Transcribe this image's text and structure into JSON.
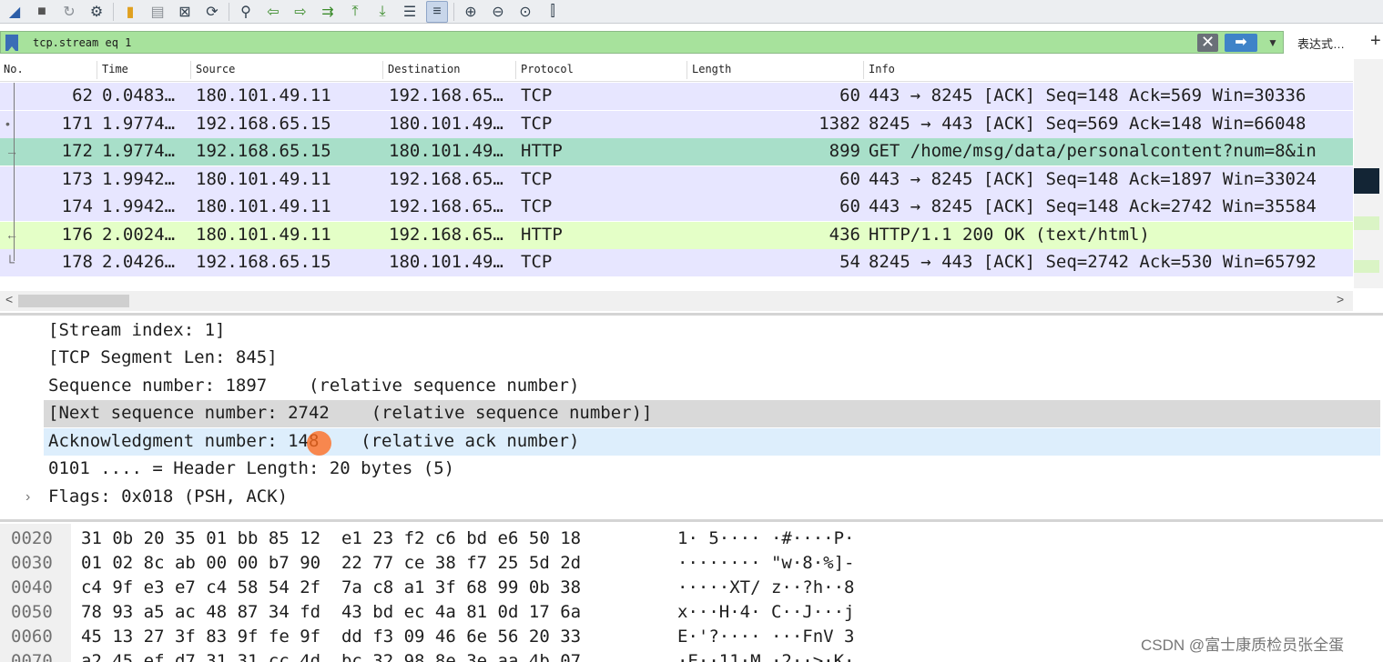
{
  "toolbar": {
    "icons": [
      "shark-fin-start-icon",
      "stop-square-icon",
      "restart-icon",
      "capture-options-icon",
      "open-folder-icon",
      "save-file-icon",
      "close-file-icon",
      "reload-file-icon",
      "find-packet-icon",
      "go-back-icon",
      "go-forward-icon",
      "go-to-packet-icon",
      "first-packet-icon",
      "last-packet-icon",
      "autoscroll-icon",
      "colorize-icon",
      "zoom-in-icon",
      "zoom-out-icon",
      "zoom-reset-icon",
      "resize-columns-icon"
    ]
  },
  "filter": {
    "value": "tcp.stream eq 1",
    "expression_label": "表达式…",
    "plus_label": "+",
    "clear_label": "✕",
    "apply_label": "➡",
    "dropdown_label": "▼"
  },
  "packet_list": {
    "columns": [
      "No.",
      "Time",
      "Source",
      "Destination",
      "Protocol",
      "Length",
      "Info"
    ],
    "rows": [
      {
        "no": "62",
        "time": "0.0483…",
        "source": "180.101.49.11",
        "destination": "192.168.65…",
        "protocol": "TCP",
        "length": "60",
        "info": "443 → 8245 [ACK] Seq=148 Ack=569 Win=30336",
        "color": "#e7e6ff"
      },
      {
        "no": "171",
        "time": "1.9774…",
        "source": "192.168.65.15",
        "destination": "180.101.49…",
        "protocol": "TCP",
        "length": "1382",
        "info": "8245 → 443 [ACK] Seq=569 Ack=148 Win=66048",
        "color": "#e7e6ff"
      },
      {
        "no": "172",
        "time": "1.9774…",
        "source": "192.168.65.15",
        "destination": "180.101.49…",
        "protocol": "HTTP",
        "length": "899",
        "info": "GET /home/msg/data/personalcontent?num=8&in",
        "color": "#a8dfc9"
      },
      {
        "no": "173",
        "time": "1.9942…",
        "source": "180.101.49.11",
        "destination": "192.168.65…",
        "protocol": "TCP",
        "length": "60",
        "info": "443 → 8245 [ACK] Seq=148 Ack=1897 Win=33024",
        "color": "#e7e6ff"
      },
      {
        "no": "174",
        "time": "1.9942…",
        "source": "180.101.49.11",
        "destination": "192.168.65…",
        "protocol": "TCP",
        "length": "60",
        "info": "443 → 8245 [ACK] Seq=148 Ack=2742 Win=35584",
        "color": "#e7e6ff"
      },
      {
        "no": "176",
        "time": "2.0024…",
        "source": "180.101.49.11",
        "destination": "192.168.65…",
        "protocol": "HTTP",
        "length": "436",
        "info": "HTTP/1.1 200 OK  (text/html)",
        "color": "#e4ffc7"
      },
      {
        "no": "178",
        "time": "2.0426…",
        "source": "192.168.65.15",
        "destination": "180.101.49…",
        "protocol": "TCP",
        "length": "54",
        "info": "8245 → 443 [ACK] Seq=2742 Ack=530 Win=65792",
        "color": "#e7e6ff"
      }
    ],
    "scroll_left": "<",
    "scroll_right": ">"
  },
  "details": {
    "lines": [
      "[Stream index: 1]",
      "[TCP Segment Len: 845]",
      "Sequence number: 1897    (relative sequence number)",
      "[Next sequence number: 2742    (relative sequence number)]",
      "Acknowledgment number: 148    (relative ack number)",
      "0101 .... = Header Length: 20 bytes (5)",
      "Flags: 0x018 (PSH, ACK)"
    ],
    "expander": "›"
  },
  "hex": {
    "rows": [
      {
        "offset": "0020",
        "bytes": "31 0b 20 35 01 bb 85 12  e1 23 f2 c6 bd e6 50 18",
        "ascii": "1· 5···· ·#····P·"
      },
      {
        "offset": "0030",
        "bytes": "01 02 8c ab 00 00 b7 90  22 77 ce 38 f7 25 5d 2d",
        "ascii": "········ \"w·8·%]-"
      },
      {
        "offset": "0040",
        "bytes": "c4 9f e3 e7 c4 58 54 2f  7a c8 a1 3f 68 99 0b 38",
        "ascii": "·····XT/ z··?h··8"
      },
      {
        "offset": "0050",
        "bytes": "78 93 a5 ac 48 87 34 fd  43 bd ec 4a 81 0d 17 6a",
        "ascii": "x···H·4· C··J···j"
      },
      {
        "offset": "0060",
        "bytes": "45 13 27 3f 83 9f fe 9f  dd f3 09 46 6e 56 20 33",
        "ascii": "E·'?···· ···FnV 3"
      },
      {
        "offset": "0070",
        "bytes": "a2 45 ef d7 31 31 cc 4d  bc 32 98 8e 3e aa 4b 07",
        "ascii": "·E··11·M ·2··>·K·"
      }
    ]
  },
  "watermark": "CSDN @富士康质检员张全蛋"
}
